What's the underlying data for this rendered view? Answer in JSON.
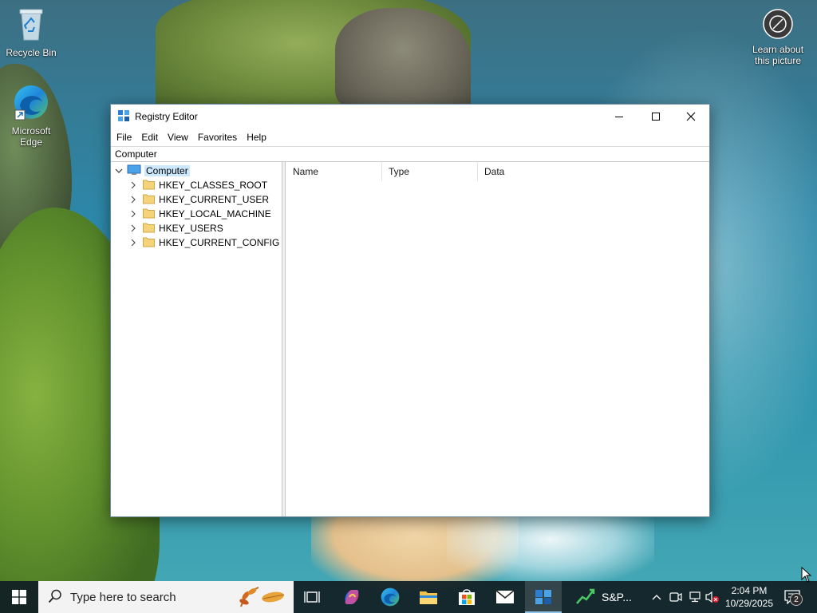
{
  "desktop": {
    "icons": [
      {
        "label": "Recycle Bin",
        "icon": "recycle-bin-icon"
      },
      {
        "label": "Microsoft Edge",
        "icon": "edge-icon"
      },
      {
        "label": "Learn about this picture",
        "icon": "camera-info-icon"
      }
    ]
  },
  "window": {
    "title": "Registry Editor",
    "app_icon": "registry-icon",
    "controls": {
      "minimize": "minimize-icon",
      "maximize": "maximize-icon",
      "close": "close-icon"
    },
    "menu": [
      "File",
      "Edit",
      "View",
      "Favorites",
      "Help"
    ],
    "address": "Computer",
    "tree": {
      "root": "Computer",
      "hives": [
        "HKEY_CLASSES_ROOT",
        "HKEY_CURRENT_USER",
        "HKEY_LOCAL_MACHINE",
        "HKEY_USERS",
        "HKEY_CURRENT_CONFIG"
      ]
    },
    "list": {
      "columns": [
        "Name",
        "Type",
        "Data"
      ],
      "rows": []
    }
  },
  "taskbar": {
    "search_placeholder": "Type here to search",
    "pinned": [
      "task-view-icon",
      "copilot-icon",
      "edge-icon",
      "file-explorer-icon",
      "microsoft-store-icon",
      "mail-icon",
      "registry-icon"
    ],
    "stock_label": "S&P...",
    "tray": [
      "chevron-up-icon",
      "meet-now-icon",
      "network-icon",
      "volume-muted-icon"
    ],
    "time": "2:04 PM",
    "date": "10/29/2025",
    "notification_count": "2"
  },
  "colors": {
    "accent": "#0078d7",
    "selection": "#cce8ff",
    "taskbar": "#101e24"
  }
}
